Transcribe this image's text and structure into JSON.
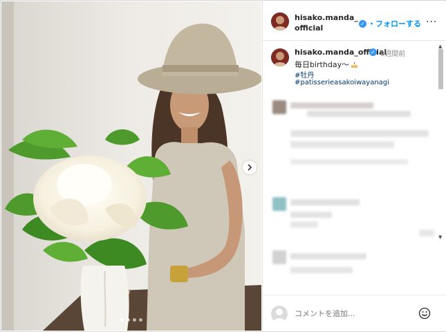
{
  "header": {
    "username": "hisako.manda_official",
    "follow_label": "・フォローする",
    "more_icon": "more-dots-icon"
  },
  "post": {
    "username": "hisako.manda_official",
    "time": "5週間前",
    "caption": "毎日birthday〜",
    "hashtags": [
      "#牡丹",
      "#patisserieasakoiwayanagi"
    ]
  },
  "comment_box": {
    "placeholder": "コメントを追加...",
    "emoji_icon": "smile-icon"
  },
  "carousel": {
    "dots": 4,
    "active_index": 0
  },
  "colors": {
    "link": "#00376b",
    "follow": "#0095f6",
    "verified": "#3897f0"
  }
}
